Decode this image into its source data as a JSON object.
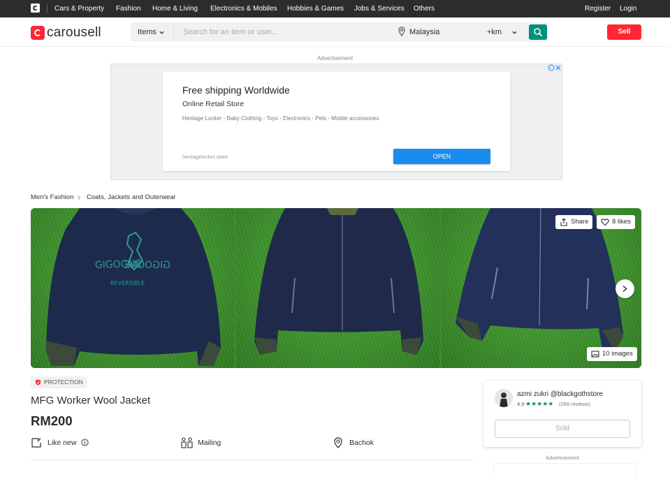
{
  "topbar": {
    "categories": [
      "Cars & Property",
      "Fashion",
      "Home & Living",
      "Electronics & Mobiles",
      "Hobbies & Games",
      "Jobs & Services",
      "Others"
    ],
    "register": "Register",
    "login": "Login"
  },
  "header": {
    "brand": "carousell",
    "search_scope": "Items",
    "search_placeholder": "Search for an item or user...",
    "location": "Malaysia",
    "distance": "+km",
    "sell": "Sell"
  },
  "advertisement": {
    "label": "Advertisement",
    "headline": "Free shipping Worldwide",
    "store": "Online Retail Store",
    "description": "Heritage Locker - Baby Clothing - Toys - Electronics - Pets - Mobile accessories",
    "domain": "heritagelocker.store",
    "cta": "OPEN"
  },
  "breadcrumb": [
    "Men's Fashion",
    "Coats, Jackets and Outerwear"
  ],
  "gallery": {
    "share": "Share",
    "likes": "8 likes",
    "images": "10 images",
    "print_text": "GIGOGNE",
    "print_text2": "REVERSIBLE"
  },
  "listing": {
    "badge": "PROTECTION",
    "title": "MFG Worker Wool Jacket",
    "price": "RM200",
    "condition": "Like new",
    "delivery": "Mailing",
    "location": "Bachok"
  },
  "seller": {
    "name": "azmi zukri @blackgothstore",
    "rating": "4.9",
    "stars": "★★★★★",
    "reviews": "(268 reviews)",
    "status_button": "Sold"
  },
  "sidebar_ad": {
    "label": "Advertisement"
  },
  "colors": {
    "brand_red": "#ff2636",
    "teal": "#008f79",
    "topbar": "#2c2c2d",
    "ad_blue": "#1a8cf0"
  }
}
